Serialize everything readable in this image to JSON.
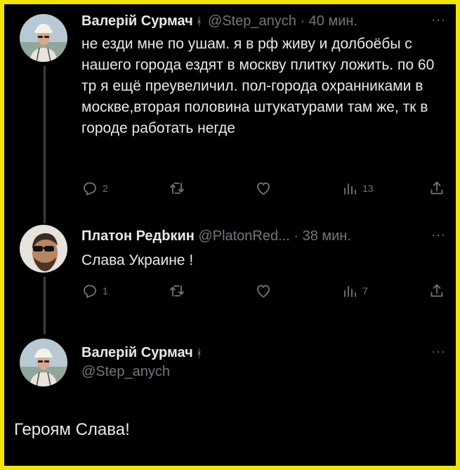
{
  "tweets": [
    {
      "name": "Валерій Сурмач",
      "badge": "ᚼ",
      "handle": "@Step_anych",
      "time": "· 40 мин.",
      "text": "не езди мне по ушам. я в рф живу и долбоёбы с нашего города  ездят в москву плитку ложить. по 60 тр я ещё преувеличил. пол-города охранниками в москве,вторая половина штукатурами там же, тк в городе работать негде",
      "replies": "2",
      "retweets": "",
      "likes": "",
      "views": "13"
    },
    {
      "name": "Платон Редbкин",
      "handle": "@PlatonRed...",
      "time": "· 38 мин.",
      "text": "Слава Украине !",
      "replies": "1",
      "retweets": "",
      "likes": "",
      "views": "7"
    }
  ],
  "main_tweet": {
    "name": "Валерій Сурмач",
    "badge": "ᚼ",
    "handle": "@Step_anych",
    "text": "Героям Слава!"
  },
  "more_label": "···",
  "colors": {
    "page_background": "#f2e600",
    "tweet_background": "#000000",
    "primary_text": "#e7e9ea",
    "secondary_text": "#71767b",
    "thread_line": "#3a3d42"
  },
  "icons": [
    "reply-icon",
    "retweet-icon",
    "like-icon",
    "views-icon",
    "share-icon",
    "more-icon"
  ]
}
